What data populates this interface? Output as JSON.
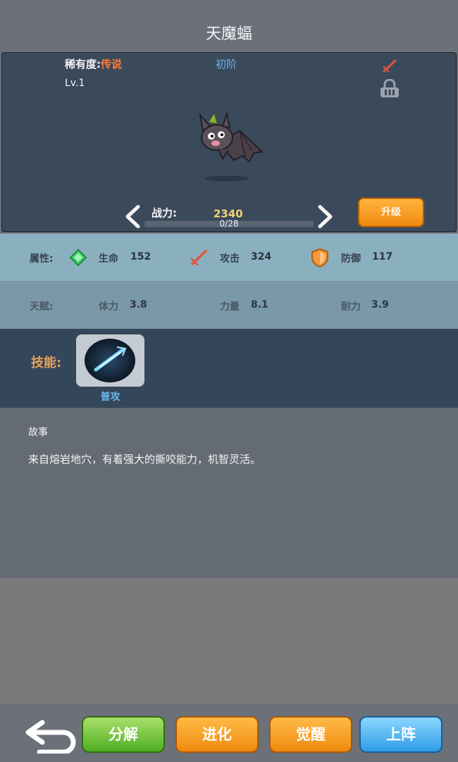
{
  "header": {
    "title": "天魔蝠"
  },
  "showcase": {
    "rarity_label": "稀有度:",
    "rarity_value": "传说",
    "stage": "初阶",
    "level": "Lv.1",
    "power_label": "战力:",
    "power_value": "2340",
    "progress_text": "0/28",
    "progress_fraction": 0.0,
    "upgrade_label": "升级"
  },
  "attributes": {
    "label": "属性:",
    "items": [
      {
        "name": "生命",
        "value": "152",
        "icon": "life-gem-icon"
      },
      {
        "name": "攻击",
        "value": "324",
        "icon": "sword-icon"
      },
      {
        "name": "防御",
        "value": "117",
        "icon": "shield-icon"
      }
    ]
  },
  "talents": {
    "label": "天赋:",
    "items": [
      {
        "name": "体力",
        "value": "3.8"
      },
      {
        "name": "力量",
        "value": "8.1"
      },
      {
        "name": "耐力",
        "value": "3.9"
      }
    ]
  },
  "skills": {
    "label": "技能:",
    "items": [
      {
        "name": "普攻",
        "icon": "normal-attack-icon"
      }
    ]
  },
  "story": {
    "title": "故事",
    "text": "来自熔岩地穴，有着强大的撕咬能力，机智灵活。"
  },
  "actions": {
    "decompose": "分解",
    "evolve": "进化",
    "awaken": "觉醒",
    "deploy": "上阵"
  },
  "colors": {
    "rarity_legend": "#ff7a3a",
    "power": "#f3d074",
    "accent_blue": "#6bb8e8"
  }
}
